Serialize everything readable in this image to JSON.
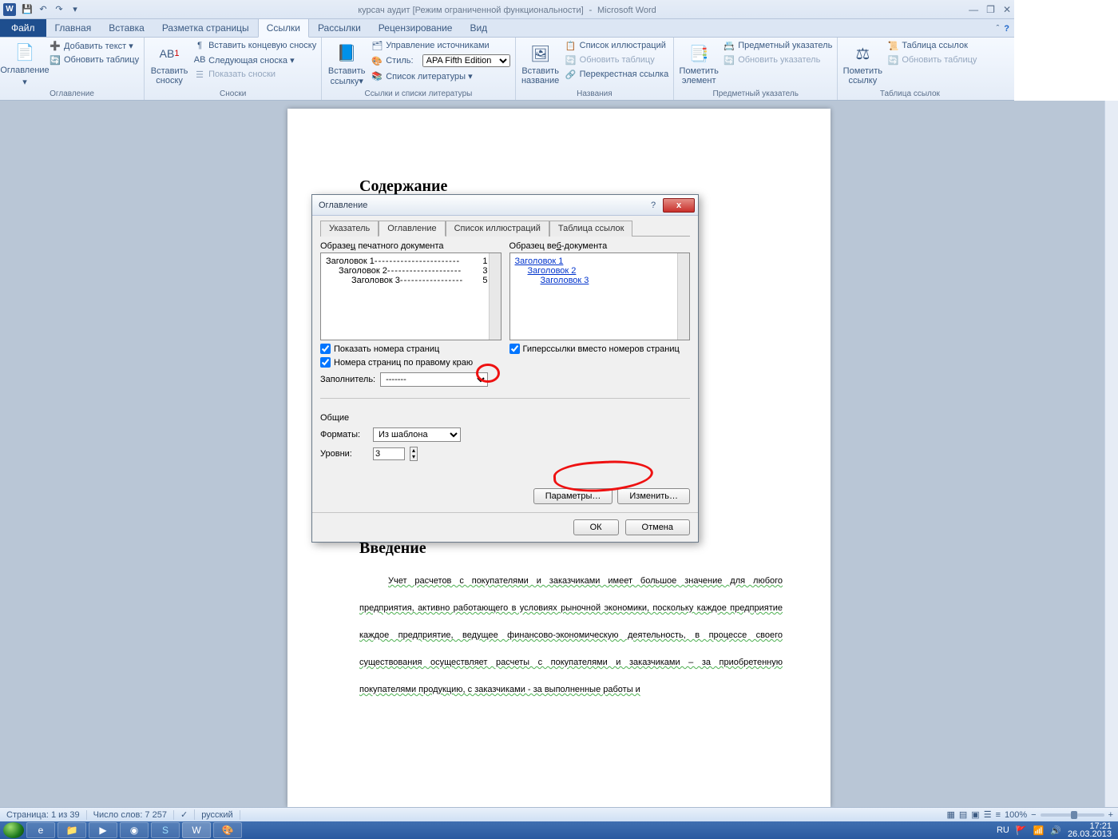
{
  "qat": {
    "title_doc": "курсач аудит [Режим ограниченной функциональности]",
    "title_app": "Microsoft Word"
  },
  "tabs": {
    "file": "Файл",
    "items": [
      "Главная",
      "Вставка",
      "Разметка страницы",
      "Ссылки",
      "Рассылки",
      "Рецензирование",
      "Вид"
    ],
    "active": 3
  },
  "ribbon": {
    "g1": {
      "label": "Оглавление",
      "big": "Оглавление",
      "i1": "Добавить текст ▾",
      "i2": "Обновить таблицу"
    },
    "g2": {
      "label": "Сноски",
      "big": "Вставить сноску",
      "i1": "Вставить концевую сноску",
      "i2": "Следующая сноска ▾",
      "i3": "Показать сноски"
    },
    "g3": {
      "label": "Ссылки и списки литературы",
      "big": "Вставить ссылку▾",
      "i1": "Управление источниками",
      "i2l": "Стиль:",
      "i2v": "APA Fifth Edition",
      "i3": "Список литературы ▾"
    },
    "g4": {
      "label": "Названия",
      "big": "Вставить название",
      "i1": "Список иллюстраций",
      "i2": "Обновить таблицу",
      "i3": "Перекрестная ссылка"
    },
    "g5": {
      "label": "Предметный указатель",
      "big": "Пометить элемент",
      "i1": "Предметный указатель",
      "i2": "Обновить указатель"
    },
    "g6": {
      "label": "Таблица ссылок",
      "big": "Пометить ссылку",
      "i1": "Таблица ссылок",
      "i2": "Обновить таблицу"
    }
  },
  "document": {
    "h1": "Содержание",
    "h2": "Введение",
    "para": "Учет расчетов с покупателями и заказчиками имеет большое значение для любого предприятия, активно работающего в условиях рыночной экономики, поскольку каждое предприятие каждое предприятие, ведущее финансово-экономическую деятельность, в процессе своего существования осуществляет расчеты с покупателями и заказчиками – за приобретенную покупателями продукцию, с заказчиками - за выполненные работы и"
  },
  "dialog": {
    "title": "Оглавление",
    "tabs": [
      "Указатель",
      "Оглавление",
      "Список иллюстраций",
      "Таблица ссылок"
    ],
    "tab_active": 1,
    "preview_print": "Образец печатного документа",
    "preview_web": "Образец веб-документа",
    "toc_print": [
      {
        "text": "Заголовок 1",
        "page": "1",
        "indent": 0
      },
      {
        "text": "Заголовок 2",
        "page": "3",
        "indent": 1
      },
      {
        "text": "Заголовок 3",
        "page": "5",
        "indent": 2
      }
    ],
    "toc_web": [
      "Заголовок 1",
      "Заголовок 2",
      "Заголовок 3"
    ],
    "chk_show_pages": "Показать номера страниц",
    "chk_right_align": "Номера страниц по правому краю",
    "chk_hyperlinks": "Гиперссылки вместо номеров страниц",
    "leader_label": "Заполнитель:",
    "leader_value": "-------",
    "general_label": "Общие",
    "formats_label": "Форматы:",
    "formats_value": "Из шаблона",
    "levels_label": "Уровни:",
    "levels_value": "3",
    "btn_params": "Параметры…",
    "btn_modify": "Изменить…",
    "btn_ok": "ОК",
    "btn_cancel": "Отмена"
  },
  "status": {
    "page": "Страница: 1 из 39",
    "words": "Число слов: 7 257",
    "lang": "русский",
    "zoom": "100%"
  },
  "tray": {
    "lang": "RU",
    "time": "17:21",
    "date": "26.03.2013"
  }
}
